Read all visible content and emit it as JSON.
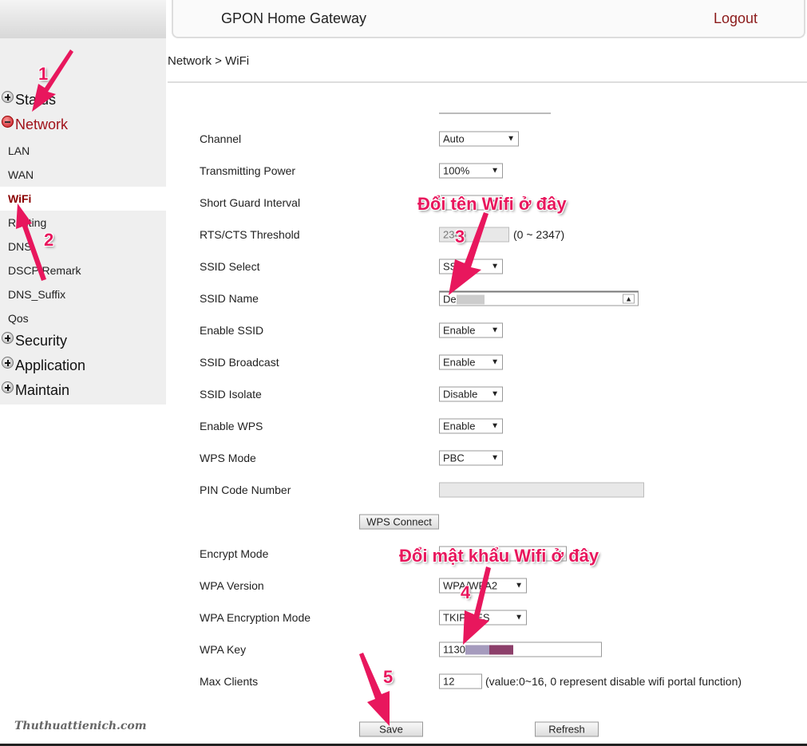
{
  "header": {
    "title": "GPON Home Gateway",
    "logout": "Logout"
  },
  "breadcrumb": "Network > WiFi",
  "sidebar": {
    "groups": [
      {
        "label": "Status",
        "state": "collapsed"
      },
      {
        "label": "Network",
        "state": "expanded"
      },
      {
        "label": "Security",
        "state": "collapsed"
      },
      {
        "label": "Application",
        "state": "collapsed"
      },
      {
        "label": "Maintain",
        "state": "collapsed"
      }
    ],
    "network_items": [
      {
        "label": "LAN"
      },
      {
        "label": "WAN"
      },
      {
        "label": "WiFi",
        "active": true
      },
      {
        "label": "Routing"
      },
      {
        "label": "DNS"
      },
      {
        "label": "DSCP Remark"
      },
      {
        "label": "DNS_Suffix"
      },
      {
        "label": "Qos"
      }
    ]
  },
  "form": {
    "channel": {
      "label": "Channel",
      "value": "Auto"
    },
    "tx_power": {
      "label": "Transmitting Power",
      "value": "100%"
    },
    "sgi": {
      "label": "Short Guard Interval",
      "value": ""
    },
    "rts": {
      "label": "RTS/CTS Threshold",
      "value": "2346",
      "note": "(0 ~ 2347)"
    },
    "ssid_select": {
      "label": "SSID Select",
      "value": "SSID1"
    },
    "ssid_name": {
      "label": "SSID Name",
      "value": "De"
    },
    "enable_ssid": {
      "label": "Enable SSID",
      "value": "Enable"
    },
    "ssid_broadcast": {
      "label": "SSID Broadcast",
      "value": "Enable"
    },
    "ssid_isolate": {
      "label": "SSID Isolate",
      "value": "Disable"
    },
    "enable_wps": {
      "label": "Enable WPS",
      "value": "Enable"
    },
    "wps_mode": {
      "label": "WPS Mode",
      "value": "PBC"
    },
    "pin": {
      "label": "PIN Code Number",
      "value": ""
    },
    "wps_connect": "WPS Connect",
    "encrypt_mode": {
      "label": "Encrypt Mode",
      "value": ""
    },
    "wpa_version": {
      "label": "WPA Version",
      "value": "WPA/WPA2"
    },
    "wpa_enc": {
      "label": "WPA Encryption Mode",
      "value": "TKIP/AES"
    },
    "wpa_key": {
      "label": "WPA Key",
      "value": "1130"
    },
    "max_clients": {
      "label": "Max Clients",
      "value": "12",
      "note": "(value:0~16, 0 represent disable wifi portal function)"
    },
    "save": "Save",
    "refresh": "Refresh"
  },
  "annotations": {
    "n1": "1",
    "n2": "2",
    "n3": "3",
    "n4": "4",
    "n5": "5",
    "rename": "Đổi tên Wifi ở đây",
    "password": "Đổi mật khẩu Wifi ở đây",
    "color": "#e8175d"
  },
  "watermark": "Thuthuattienich.com"
}
